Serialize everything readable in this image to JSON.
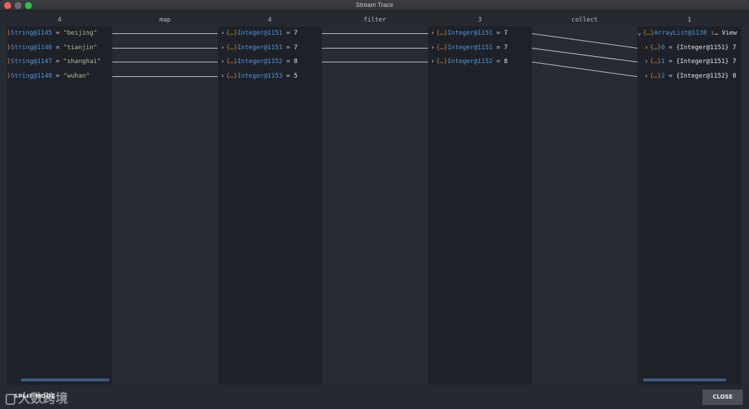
{
  "window": {
    "title": "Stream Trace"
  },
  "columns": [
    {
      "header": "4"
    },
    {
      "header": "map"
    },
    {
      "header": "4"
    },
    {
      "header": "filter"
    },
    {
      "header": "3"
    },
    {
      "header": "collect"
    },
    {
      "header": "1"
    }
  ],
  "source": [
    {
      "name": "String@1145",
      "value": "\"beijing\""
    },
    {
      "name": "String@1146",
      "value": "\"tianjin\""
    },
    {
      "name": "String@1147",
      "value": "\"shanghai\""
    },
    {
      "name": "String@1148",
      "value": "\"wuhan\""
    }
  ],
  "mapped": [
    {
      "name": "Integer@1151",
      "value": "7"
    },
    {
      "name": "Integer@1151",
      "value": "7"
    },
    {
      "name": "Integer@1152",
      "value": "8"
    },
    {
      "name": "Integer@1153",
      "value": "5"
    }
  ],
  "filtered": [
    {
      "name": "Integer@1151",
      "value": "7"
    },
    {
      "name": "Integer@1151",
      "value": "7"
    },
    {
      "name": "Integer@1152",
      "value": "8"
    }
  ],
  "result": {
    "name": "ArrayList@1138",
    "suffix": ":… View",
    "items": [
      {
        "index": "0",
        "value": "{Integer@1151} 7"
      },
      {
        "index": "1",
        "value": "{Integer@1151} 7"
      },
      {
        "index": "2",
        "value": "{Integer@1152} 8"
      }
    ]
  },
  "glyphs": {
    "braces": "{…}",
    "eq": "=",
    "expand": "›",
    "collapse": "⌄"
  },
  "footer": {
    "split_mode": "SPLIT MODE",
    "close": "CLOSE"
  },
  "watermark": "大数跨境",
  "colors": {
    "name": "#4f97e6",
    "braces": "#c77c3b",
    "string": "#b4c08f",
    "link": "#c9ccd1",
    "scroll": "#3c5a85"
  }
}
